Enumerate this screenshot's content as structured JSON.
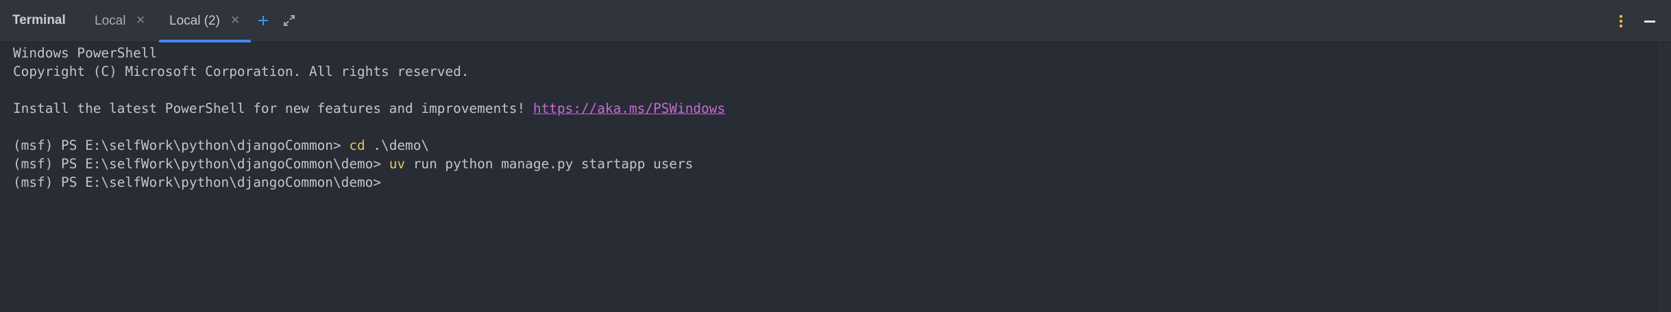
{
  "panel": {
    "title": "Terminal"
  },
  "tabs": [
    {
      "label": "Local",
      "active": false,
      "close_glyph": "×"
    },
    {
      "label": "Local (2)",
      "active": true,
      "close_glyph": "×"
    }
  ],
  "toolbar": {
    "new_tab_icon": "plus-icon",
    "maximize_icon": "expand-icon",
    "options_icon": "kebab-menu-icon",
    "hide_icon": "minimize-icon"
  },
  "colors": {
    "background": "#282c34",
    "tabbar_background": "#2f343d",
    "text": "#c1c6ce",
    "command": "#e5c65a",
    "link": "#c76ad6",
    "active_tab_underline": "#4a88f5",
    "new_tab_icon": "#3d9be9",
    "options_icon": "#e8c23c"
  },
  "terminal": {
    "banner_line1": "Windows PowerShell",
    "banner_line2": "Copyright (C) Microsoft Corporation. All rights reserved.",
    "install_text": "Install the latest PowerShell for new features and improvements! ",
    "install_link": "https://aka.ms/PSWindows",
    "commands": [
      {
        "prompt": "(msf) PS E:\\selfWork\\python\\djangoCommon> ",
        "command": "cd",
        "args": " .\\demo\\"
      },
      {
        "prompt": "(msf) PS E:\\selfWork\\python\\djangoCommon\\demo> ",
        "command": "uv",
        "args": " run python manage.py startapp users"
      }
    ],
    "current_prompt": "(msf) PS E:\\selfWork\\python\\djangoCommon\\demo> "
  }
}
